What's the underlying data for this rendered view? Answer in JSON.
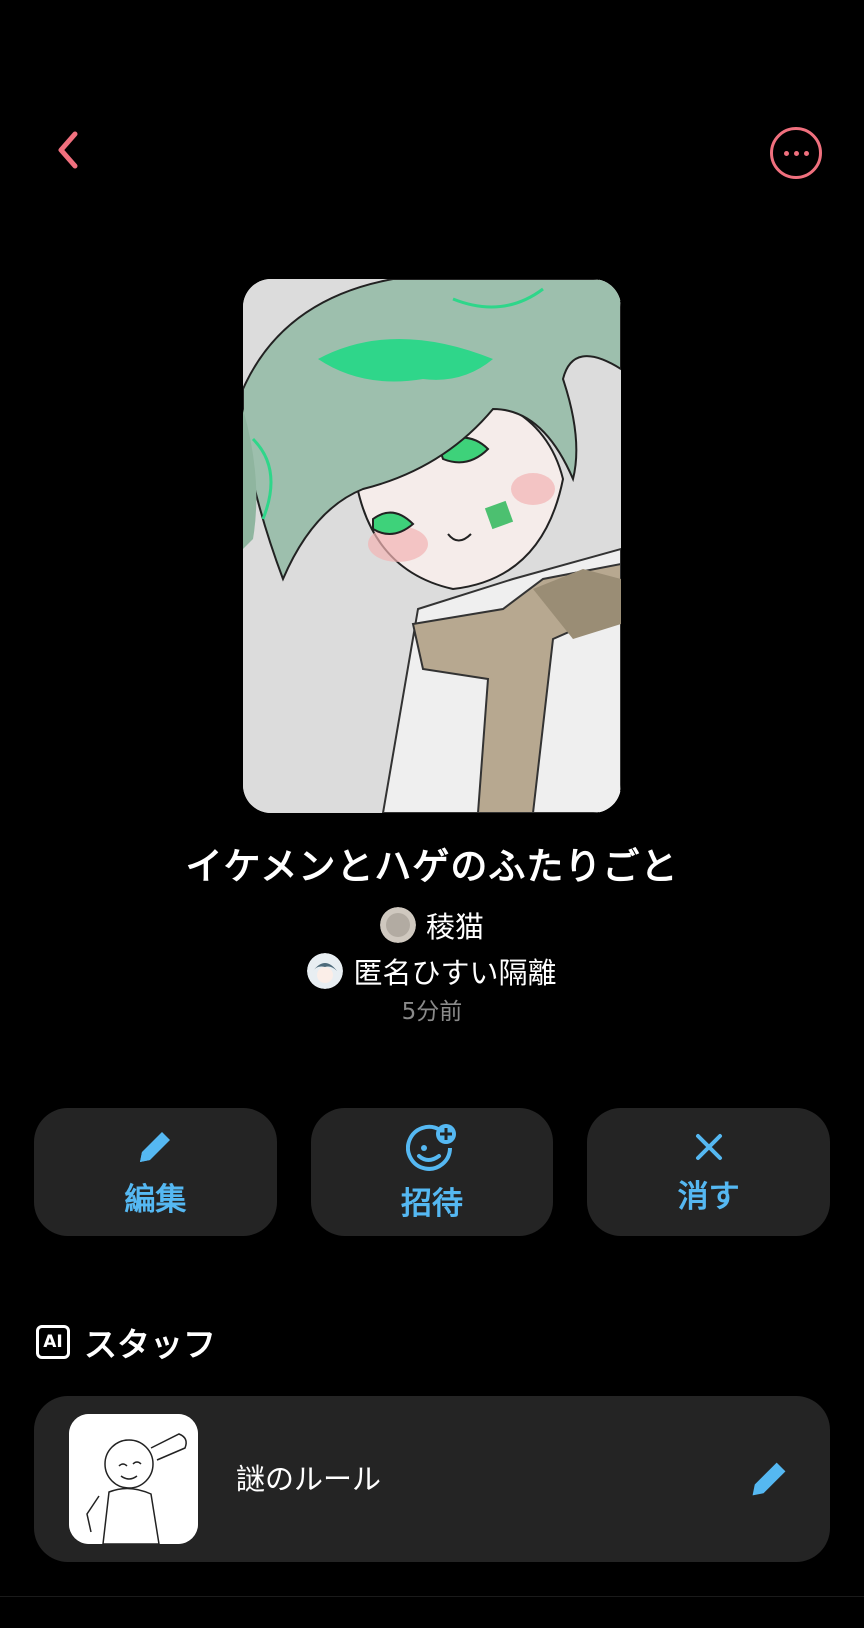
{
  "header": {
    "back_icon": "chevron-left-icon",
    "more_icon": "more-horizontal-icon",
    "accent": "#f0707e"
  },
  "story": {
    "title": "イケメンとハゲのふたりごと",
    "author_1": "稜猫",
    "author_2": "匿名ひすい隔離",
    "time": "5分前"
  },
  "actions": [
    {
      "label": "編集",
      "icon": "pencil-icon"
    },
    {
      "label": "招待",
      "icon": "add-user-icon"
    },
    {
      "label": "消す",
      "icon": "close-icon"
    }
  ],
  "staff": {
    "section_title": "スタッフ",
    "section_badge": "AI",
    "items": [
      {
        "name": "謎のルール",
        "edit_icon": "pencil-icon"
      }
    ]
  },
  "colors": {
    "action_blue": "#55b8f2",
    "card_bg": "#242424"
  }
}
